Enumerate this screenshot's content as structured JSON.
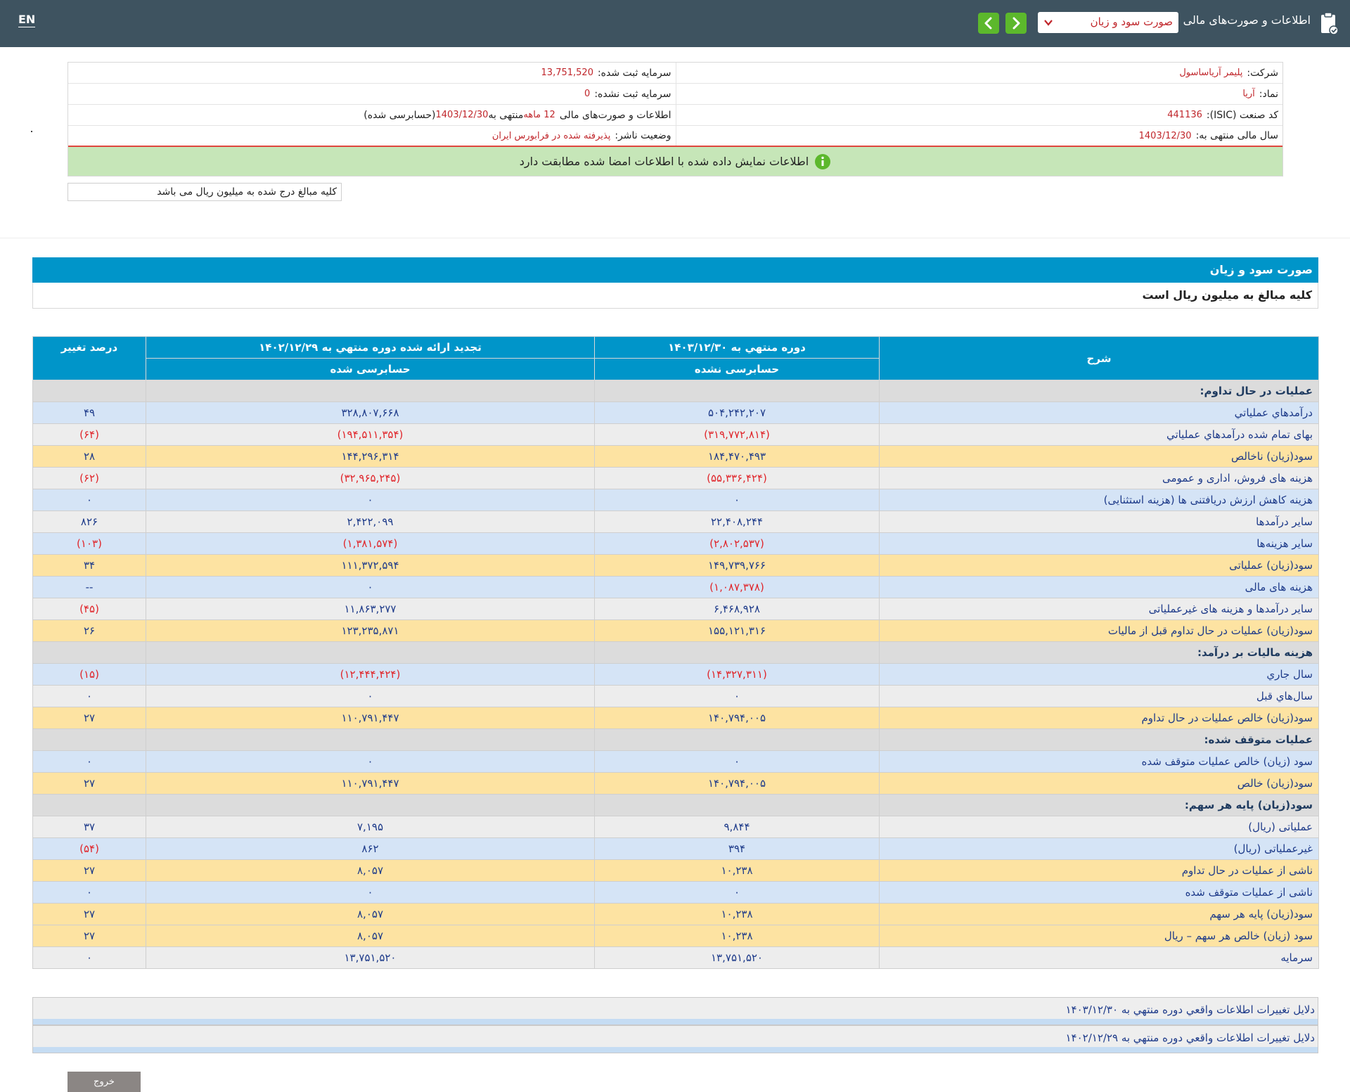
{
  "topbar": {
    "lang": "EN",
    "title": "اطلاعات و صورت‌های مالی",
    "selected_report": "صورت سود و زیان"
  },
  "company": {
    "company_label": "شرکت:",
    "company_value": "پلیمر آریاساسول",
    "symbol_label": "نماد:",
    "symbol_value": "آریا",
    "isic_label": "کد صنعت (ISIC):",
    "isic_value": "441136",
    "fiscal_label": "سال مالی منتهی به:",
    "fiscal_value": "1403/12/30",
    "reg_capital_label": "سرمایه ثبت شده:",
    "reg_capital_value": "13,751,520",
    "unreg_capital_label": "سرمایه ثبت نشده:",
    "unreg_capital_value": "0",
    "statements_label": "اطلاعات و صورت‌های مالی",
    "statements_period": "12 ماهه",
    "statements_mid": "منتهی به",
    "statements_date": "1403/12/30",
    "statements_status": "(حسابرسی شده)",
    "publisher_label": "وضعیت ناشر:",
    "publisher_value": "پذیرفته شده در فرابورس ایران"
  },
  "match_notice": "اطلاعات نمایش داده شده با اطلاعات امضا شده مطابقت دارد",
  "unit_note": "کلیه مبالغ درج شده به میلیون ریال می باشد",
  "report": {
    "title": "صورت سود و زیان",
    "subtitle": "کلیه مبالغ به میلیون ریال است"
  },
  "table": {
    "headers": {
      "desc": "شرح",
      "period1": "دوره منتهي به ۱۴۰۳/۱۲/۳۰",
      "period2": "تجدید ارائه شده دوره منتهي به ۱۴۰۲/۱۲/۲۹",
      "change": "درصد تغییر",
      "audit1": "حسابرسی نشده",
      "audit2": "حسابرسی شده"
    },
    "rows": [
      {
        "type": "sec",
        "desc": "عملیات در حال تداوم:"
      },
      {
        "type": "bl",
        "desc": "درآمدهاي عملياتي",
        "v1": "۵۰۴,۲۴۲,۲۰۷",
        "v2": "۳۲۸,۸۰۷,۶۶۸",
        "pct": "۴۹"
      },
      {
        "type": "gr",
        "desc": "بهاى تمام شده درآمدهاي عملياتي",
        "v1": "(۳۱۹,۷۷۲,۸۱۴)",
        "v2": "(۱۹۴,۵۱۱,۳۵۴)",
        "pct": "(۶۴)"
      },
      {
        "type": "yl",
        "desc": "سود(زيان) ناخالص",
        "v1": "۱۸۴,۴۷۰,۴۹۳",
        "v2": "۱۴۴,۲۹۶,۳۱۴",
        "pct": "۲۸"
      },
      {
        "type": "gr",
        "desc": "هزينه هاى فروش، ادارى و عمومى",
        "v1": "(۵۵,۳۳۶,۴۲۴)",
        "v2": "(۳۲,۹۶۵,۲۴۵)",
        "pct": "(۶۲)"
      },
      {
        "type": "bl",
        "desc": "هزینه کاهش ارزش دریافتنی ها (هزینه استثنایی)",
        "v1": "۰",
        "v2": "۰",
        "pct": "۰"
      },
      {
        "type": "gr",
        "desc": "ساير درآمدها",
        "v1": "۲۲,۴۰۸,۲۴۴",
        "v2": "۲,۴۲۲,۰۹۹",
        "pct": "۸۲۶"
      },
      {
        "type": "bl",
        "desc": "سایر هزینه‌ها",
        "v1": "(۲,۸۰۲,۵۳۷)",
        "v2": "(۱,۳۸۱,۵۷۴)",
        "pct": "(۱۰۳)"
      },
      {
        "type": "yl",
        "desc": "سود(زيان) عملياتى",
        "v1": "۱۴۹,۷۳۹,۷۶۶",
        "v2": "۱۱۱,۳۷۲,۵۹۴",
        "pct": "۳۴"
      },
      {
        "type": "bl",
        "desc": "هزينه هاى مالى",
        "v1": "(۱,۰۸۷,۳۷۸)",
        "v2": "۰",
        "pct": "--"
      },
      {
        "type": "gr",
        "desc": "ساير درآمدها و هزينه هاى غيرعملياتى",
        "v1": "۶,۴۶۸,۹۲۸",
        "v2": "۱۱,۸۶۳,۲۷۷",
        "pct": "(۴۵)"
      },
      {
        "type": "yl",
        "desc": "سود(زيان) عمليات در حال تداوم قبل از ماليات",
        "v1": "۱۵۵,۱۲۱,۳۱۶",
        "v2": "۱۲۳,۲۳۵,۸۷۱",
        "pct": "۲۶"
      },
      {
        "type": "sec",
        "desc": "هزينه ماليات بر درآمد:"
      },
      {
        "type": "bl",
        "desc": "سال جاري",
        "v1": "(۱۴,۳۲۷,۳۱۱)",
        "v2": "(۱۲,۴۴۴,۴۲۴)",
        "pct": "(۱۵)"
      },
      {
        "type": "gr",
        "desc": "سال‌هاي قبل",
        "v1": "۰",
        "v2": "۰",
        "pct": "۰"
      },
      {
        "type": "yl",
        "desc": "سود(زيان) خالص عمليات در حال تداوم",
        "v1": "۱۴۰,۷۹۴,۰۰۵",
        "v2": "۱۱۰,۷۹۱,۴۴۷",
        "pct": "۲۷"
      },
      {
        "type": "sec",
        "desc": "عملیات متوقف شده:"
      },
      {
        "type": "bl",
        "desc": "سود (زيان) خالص عمليات متوقف شده",
        "v1": "۰",
        "v2": "۰",
        "pct": "۰"
      },
      {
        "type": "yl",
        "desc": "سود(زيان) خالص",
        "v1": "۱۴۰,۷۹۴,۰۰۵",
        "v2": "۱۱۰,۷۹۱,۴۴۷",
        "pct": "۲۷"
      },
      {
        "type": "sec",
        "desc": "سود(زيان) پايه هر سهم:"
      },
      {
        "type": "gr",
        "desc": "عملیاتی (ريال)",
        "v1": "۹,۸۴۴",
        "v2": "۷,۱۹۵",
        "pct": "۳۷"
      },
      {
        "type": "bl",
        "desc": "غیرعملیاتی (ريال)",
        "v1": "۳۹۴",
        "v2": "۸۶۲",
        "pct": "(۵۴)"
      },
      {
        "type": "yl",
        "desc": "ناشی از عملیات در حال تداوم",
        "v1": "۱۰,۲۳۸",
        "v2": "۸,۰۵۷",
        "pct": "۲۷"
      },
      {
        "type": "bl",
        "desc": "ناشی از عملیات متوقف شده",
        "v1": "۰",
        "v2": "۰",
        "pct": "۰"
      },
      {
        "type": "yl",
        "desc": "سود(زيان) پايه هر سهم",
        "v1": "۱۰,۲۳۸",
        "v2": "۸,۰۵۷",
        "pct": "۲۷"
      },
      {
        "type": "yl",
        "desc": "سود (زيان) خالص هر سهم – ريال",
        "v1": "۱۰,۲۳۸",
        "v2": "۸,۰۵۷",
        "pct": "۲۷"
      },
      {
        "type": "gr",
        "desc": "سرمايه",
        "v1": "۱۳,۷۵۱,۵۲۰",
        "v2": "۱۳,۷۵۱,۵۲۰",
        "pct": "۰"
      }
    ]
  },
  "reasons": [
    "دلایل تغییرات اطلاعات واقعي دوره منتهي به ۱۴۰۳/۱۲/۳۰",
    "دلایل تغییرات اطلاعات واقعي دوره منتهي به ۱۴۰۲/۱۲/۲۹"
  ],
  "exit_label": "خروج"
}
